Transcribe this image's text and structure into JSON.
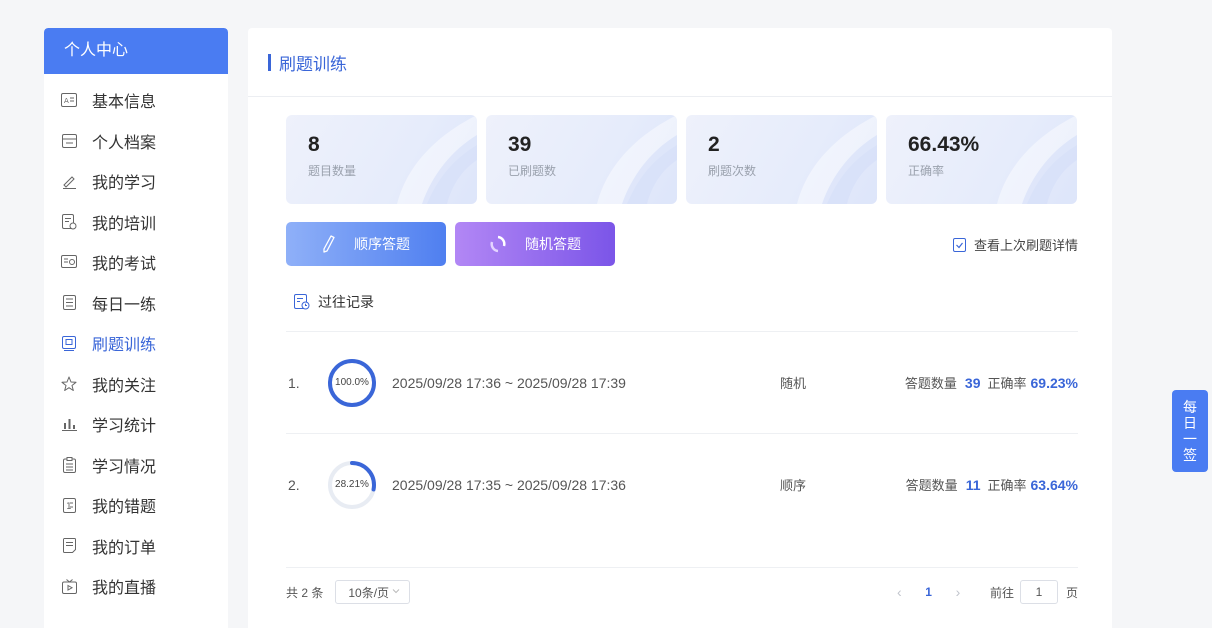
{
  "sidebar": {
    "header": "个人中心",
    "items": [
      {
        "label": "基本信息",
        "icon": "id-card-icon"
      },
      {
        "label": "个人档案",
        "icon": "archive-icon"
      },
      {
        "label": "我的学习",
        "icon": "pen-icon"
      },
      {
        "label": "我的培训",
        "icon": "training-doc-icon"
      },
      {
        "label": "我的考试",
        "icon": "exam-icon"
      },
      {
        "label": "每日一练",
        "icon": "daily-doc-icon"
      },
      {
        "label": "刷题训练",
        "icon": "practice-icon",
        "active": true
      },
      {
        "label": "我的关注",
        "icon": "star-icon"
      },
      {
        "label": "学习统计",
        "icon": "bar-chart-icon"
      },
      {
        "label": "学习情况",
        "icon": "clipboard-icon"
      },
      {
        "label": "我的错题",
        "icon": "error-list-icon"
      },
      {
        "label": "我的订单",
        "icon": "order-icon"
      },
      {
        "label": "我的直播",
        "icon": "live-icon"
      }
    ]
  },
  "panel": {
    "title": "刷题训练"
  },
  "stats": [
    {
      "value": "8",
      "label": "题目数量"
    },
    {
      "value": "39",
      "label": "已刷题数"
    },
    {
      "value": "2",
      "label": "刷题次数"
    },
    {
      "value": "66.43%",
      "label": "正确率"
    }
  ],
  "actions": {
    "sequential": "顺序答题",
    "random": "随机答题",
    "last_detail": "查看上次刷题详情"
  },
  "history": {
    "title": "过往记录",
    "count_label": "答题数量",
    "accuracy_label": "正确率",
    "records": [
      {
        "index": "1.",
        "progress": 1.0,
        "progress_text": "100.0%",
        "time": "2025/09/28 17:36 ~ 2025/09/28 17:39",
        "mode": "随机",
        "count": "39",
        "accuracy": "69.23%"
      },
      {
        "index": "2.",
        "progress": 0.2821,
        "progress_text": "28.21%",
        "time": "2025/09/28 17:35 ~ 2025/09/28 17:36",
        "mode": "顺序",
        "count": "11",
        "accuracy": "63.64%"
      }
    ]
  },
  "pagination": {
    "total": "共 2 条",
    "page_size": "10条/页",
    "current_page": "1",
    "goto_label": "前往",
    "goto_value": "1",
    "page_suffix": "页"
  },
  "float_sign": [
    "每",
    "日",
    "一",
    "签"
  ],
  "colors": {
    "accent": "#3a66d8",
    "header": "#4a7cf2",
    "ring_track": "#e8ecf3"
  }
}
